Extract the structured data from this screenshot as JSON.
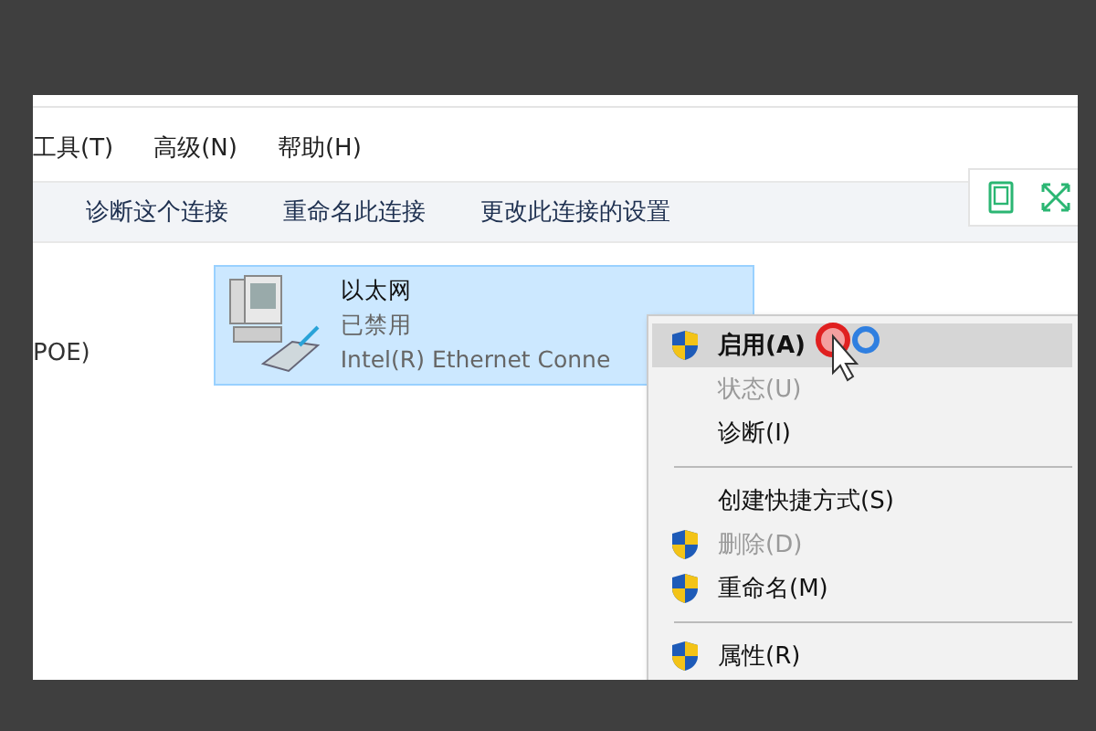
{
  "menu_bar": [
    {
      "label": "工具(T)"
    },
    {
      "label": "高级(N)"
    },
    {
      "label": "帮助(H)"
    }
  ],
  "command_bar": [
    {
      "label": "诊断这个连接"
    },
    {
      "label": "重命名此连接"
    },
    {
      "label": "更改此连接的设置"
    }
  ],
  "side_text": "POE)",
  "adapter": {
    "name": "以太网",
    "status": "已禁用",
    "device": "Intel(R) Ethernet Conne",
    "selected": true
  },
  "context_menu": [
    {
      "kind": "item",
      "label": "启用(A)",
      "shield": true,
      "disabled": false,
      "default": true,
      "selected": true
    },
    {
      "kind": "item",
      "label": "状态(U)",
      "shield": false,
      "disabled": true,
      "default": false,
      "selected": false
    },
    {
      "kind": "item",
      "label": "诊断(I)",
      "shield": false,
      "disabled": false,
      "default": false,
      "selected": false
    },
    {
      "kind": "separator"
    },
    {
      "kind": "item",
      "label": "创建快捷方式(S)",
      "shield": false,
      "disabled": false,
      "default": false,
      "selected": false
    },
    {
      "kind": "item",
      "label": "删除(D)",
      "shield": true,
      "disabled": true,
      "default": false,
      "selected": false
    },
    {
      "kind": "item",
      "label": "重命名(M)",
      "shield": true,
      "disabled": false,
      "default": false,
      "selected": false
    },
    {
      "kind": "separator"
    },
    {
      "kind": "item",
      "label": "属性(R)",
      "shield": true,
      "disabled": false,
      "default": false,
      "selected": false
    }
  ]
}
